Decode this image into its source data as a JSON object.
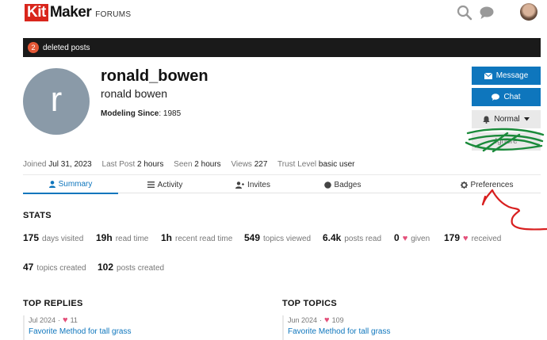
{
  "header": {
    "logo_kit": "Kit",
    "logo_maker": "Maker",
    "logo_forums": "FORUMS",
    "icons": [
      "search-icon",
      "chat-bubble-icon",
      "user-avatar"
    ]
  },
  "deleted_banner": {
    "count": "2",
    "label": "deleted posts"
  },
  "profile": {
    "avatar_letter": "r",
    "username": "ronald_bowen",
    "full_name": "ronald bowen",
    "modeling_label": "Modeling Since",
    "modeling_value": ": 1985",
    "avatar_color": "#8a9aa8"
  },
  "actions": {
    "message": "Message",
    "chat": "Chat",
    "notification_level": "Normal",
    "hidden_label": "Ignore"
  },
  "meta": {
    "joined_label": "Joined",
    "joined_value": "Jul 31, 2023",
    "last_post_label": "Last Post",
    "last_post_value": "2 hours",
    "seen_label": "Seen",
    "seen_value": "2 hours",
    "views_label": "Views",
    "views_value": "227",
    "trust_label": "Trust Level",
    "trust_value": "basic user"
  },
  "tabs": [
    {
      "label": "Summary",
      "icon": "user-icon",
      "active": true
    },
    {
      "label": "Activity",
      "icon": "list-icon",
      "active": false
    },
    {
      "label": "Invites",
      "icon": "user-plus-icon",
      "active": false
    },
    {
      "label": "Badges",
      "icon": "badge-icon",
      "active": false
    },
    {
      "label": "Preferences",
      "icon": "gear-icon",
      "active": false
    }
  ],
  "stats": {
    "title": "STATS",
    "days_visited_num": "175",
    "days_visited_label": "days visited",
    "read_time_num": "19h",
    "read_time_label": "read time",
    "recent_read_num": "1h",
    "recent_read_label": "recent read time",
    "topics_viewed_num": "549",
    "topics_viewed_label": "topics viewed",
    "posts_read_num": "6.4k",
    "posts_read_label": "posts read",
    "given_num": "0",
    "given_label": "given",
    "received_num": "179",
    "received_label": "received",
    "topics_created_num": "47",
    "topics_created_label": "topics created",
    "posts_created_num": "102",
    "posts_created_label": "posts created"
  },
  "top_replies": {
    "title": "TOP REPLIES",
    "date": "Jul 2024",
    "likes": "11",
    "link": "Favorite Method for tall grass"
  },
  "top_topics": {
    "title": "TOP TOPICS",
    "date": "Jun 2024",
    "likes": "109",
    "link": "Favorite Method for tall grass"
  },
  "colors": {
    "accent": "#0e76bd",
    "brand_red": "#d9261c",
    "heart": "#e3507a",
    "annotation_green": "#1a8a3a",
    "annotation_red": "#d81f1f"
  }
}
